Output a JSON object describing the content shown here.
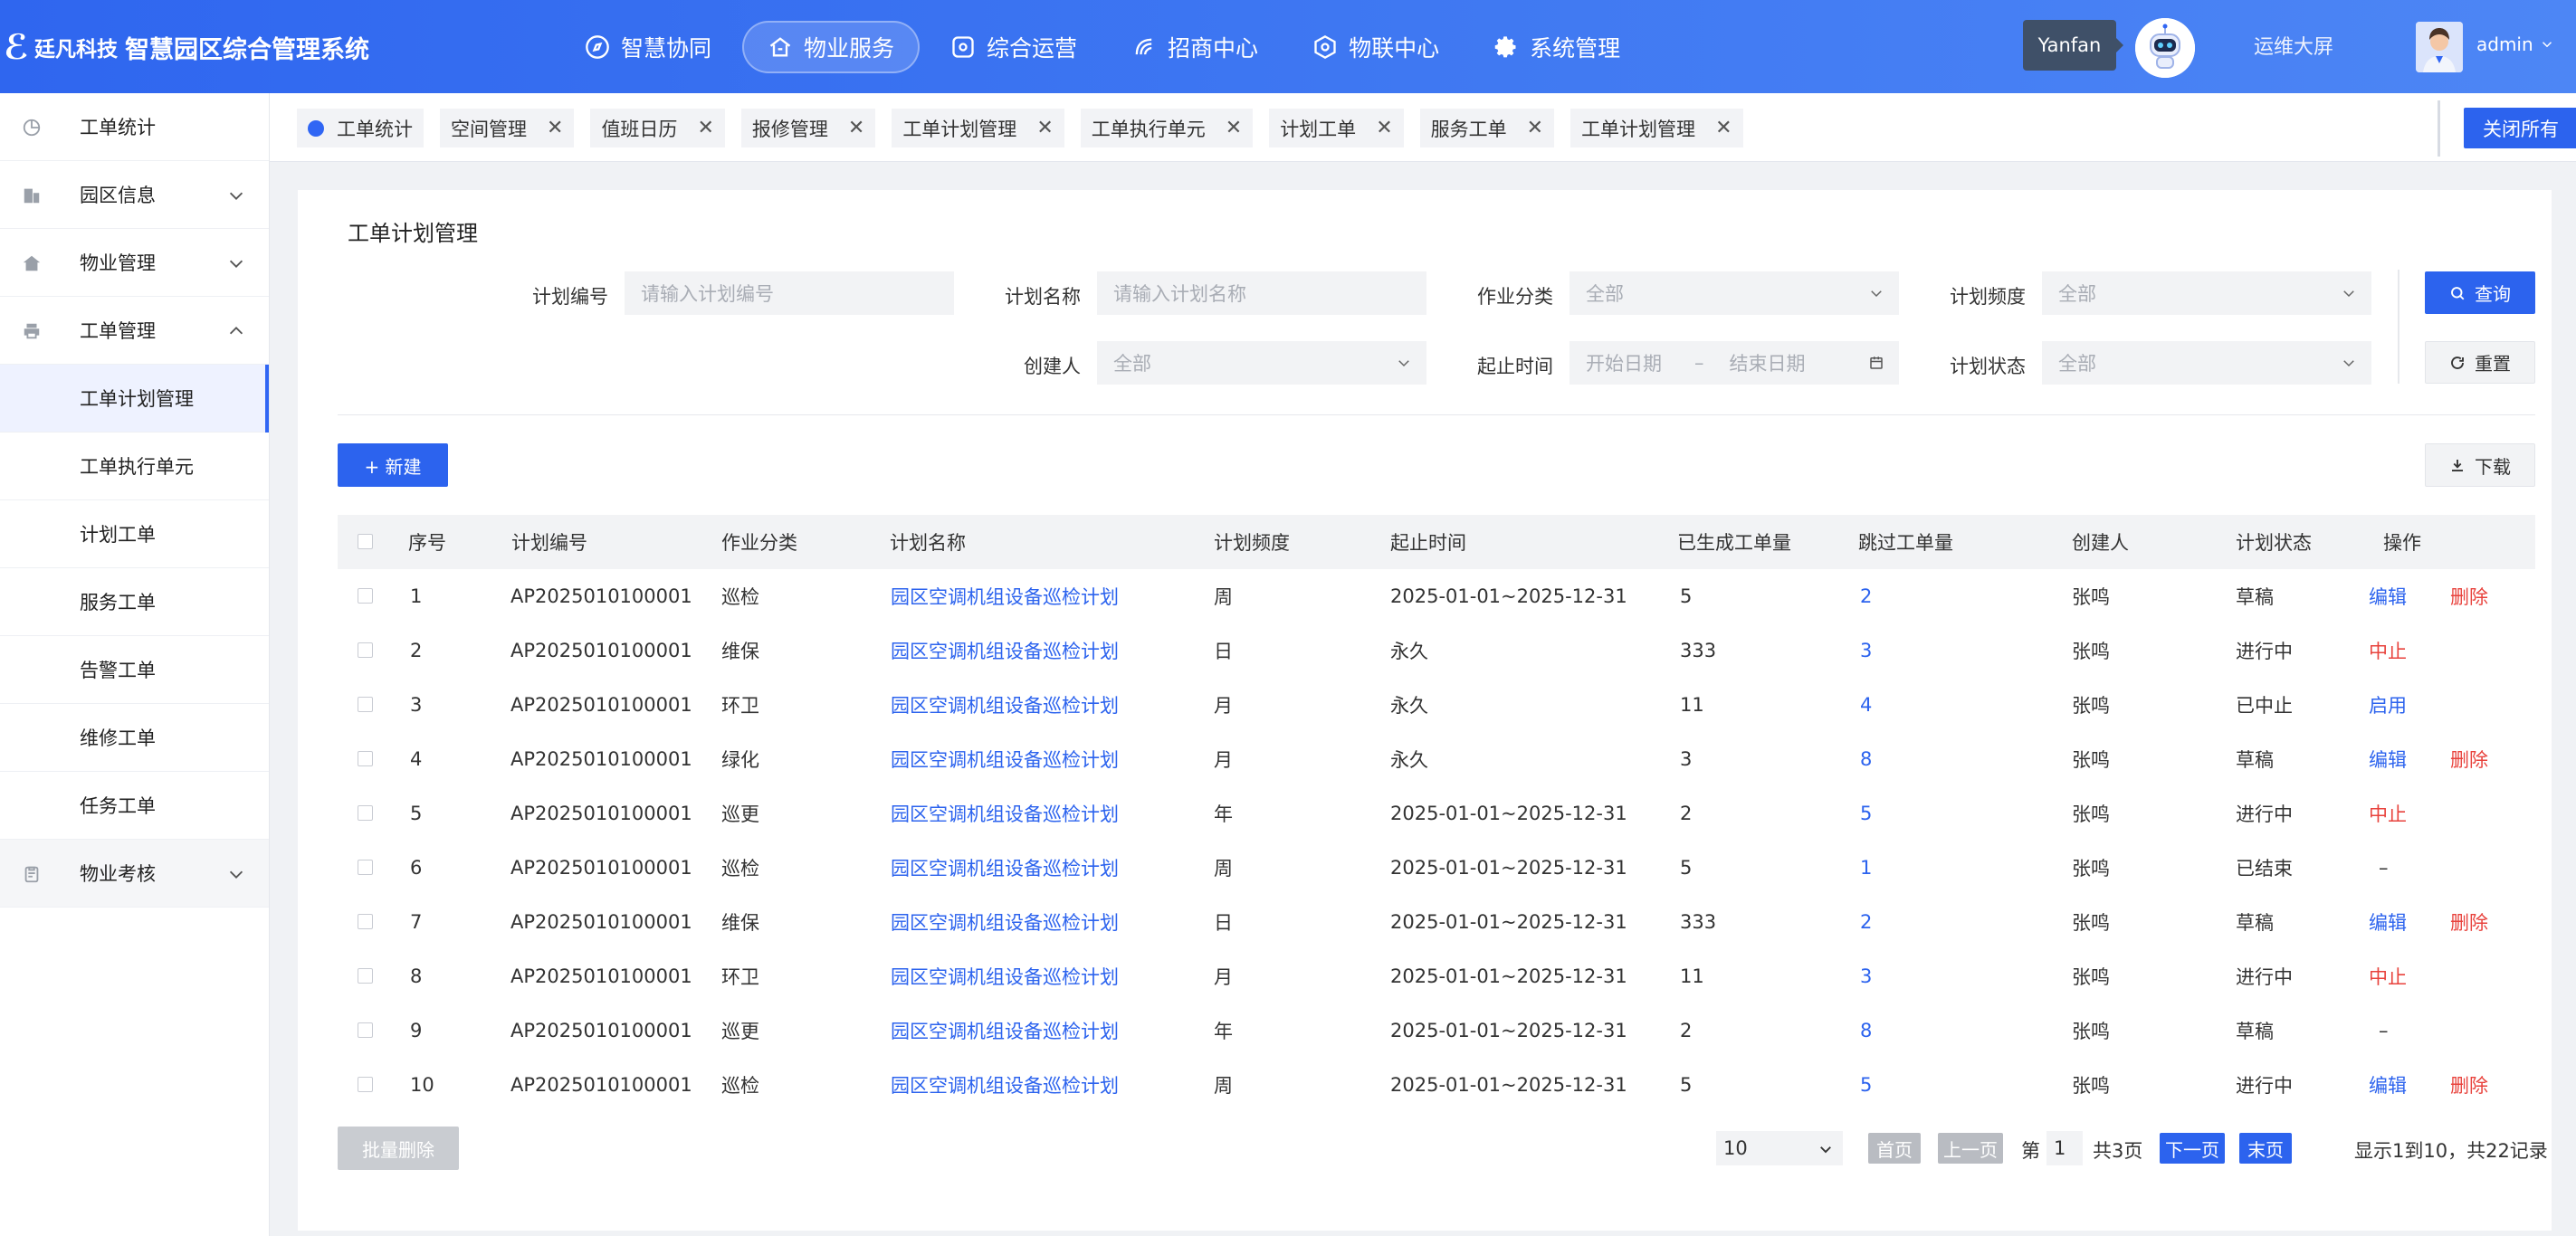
{
  "header": {
    "company": "廷凡科技",
    "system": "智慧园区综合管理系统",
    "nav": [
      {
        "label": "智慧协同",
        "icon": "compass-icon"
      },
      {
        "label": "物业服务",
        "icon": "house-icon"
      },
      {
        "label": "综合运营",
        "icon": "operations-icon"
      },
      {
        "label": "招商中心",
        "icon": "merchant-icon"
      },
      {
        "label": "物联中心",
        "icon": "iot-icon"
      },
      {
        "label": "系统管理",
        "icon": "gear-icon"
      }
    ],
    "tooltip": "Yanfan",
    "screen_link": "运维大屏",
    "user": "admin"
  },
  "sidebar": {
    "items": [
      {
        "label": "工单统计"
      },
      {
        "label": "园区信息"
      },
      {
        "label": "物业管理"
      },
      {
        "label": "工单管理"
      },
      {
        "label": "物业考核"
      }
    ],
    "sub_items": [
      {
        "label": "工单计划管理"
      },
      {
        "label": "工单执行单元"
      },
      {
        "label": "计划工单"
      },
      {
        "label": "服务工单"
      },
      {
        "label": "告警工单"
      },
      {
        "label": "维修工单"
      },
      {
        "label": "任务工单"
      }
    ]
  },
  "tabs": [
    {
      "label": "工单统计"
    },
    {
      "label": "空间管理"
    },
    {
      "label": "值班日历"
    },
    {
      "label": "报修管理"
    },
    {
      "label": "工单计划管理"
    },
    {
      "label": "工单执行单元"
    },
    {
      "label": "计划工单"
    },
    {
      "label": "服务工单"
    },
    {
      "label": "工单计划管理"
    }
  ],
  "close_all": "关闭所有",
  "page": {
    "title": "工单计划管理",
    "filters": {
      "plan_no_label": "计划编号",
      "plan_no_placeholder": "请输入计划编号",
      "plan_name_label": "计划名称",
      "plan_name_placeholder": "请输入计划名称",
      "category_label": "作业分类",
      "category_value": "全部",
      "frequency_label": "计划频度",
      "frequency_value": "全部",
      "creator_label": "创建人",
      "creator_value": "全部",
      "period_label": "起止时间",
      "start_placeholder": "开始日期",
      "range_sep": "–",
      "end_placeholder": "结束日期",
      "status_label": "计划状态",
      "status_value": "全部"
    },
    "query_btn": "查询",
    "reset_btn": "重置",
    "new_btn": "+ 新建",
    "download_btn": "下载",
    "batch_delete": "批量删除"
  },
  "table": {
    "headers": [
      "序号",
      "计划编号",
      "作业分类",
      "计划名称",
      "计划频度",
      "起止时间",
      "已生成工单量",
      "跳过工单量",
      "创建人",
      "计划状态",
      "操作"
    ],
    "rows": [
      {
        "seq": "1",
        "no": "AP2025010100001",
        "cat": "巡检",
        "name": "园区空调机组设备巡检计划",
        "freq": "周",
        "period": "2025-01-01~2025-12-31",
        "generated": "5",
        "skipped": "2",
        "creator": "张鸣",
        "status": "草稿",
        "op1": "编辑",
        "op1_color": "#2c63ee",
        "op2": "删除"
      },
      {
        "seq": "2",
        "no": "AP2025010100001",
        "cat": "维保",
        "name": "园区空调机组设备巡检计划",
        "freq": "日",
        "period": "永久",
        "generated": "333",
        "skipped": "3",
        "creator": "张鸣",
        "status": "进行中",
        "op1": "中止",
        "op1_color": "#e8423c",
        "op2": ""
      },
      {
        "seq": "3",
        "no": "AP2025010100001",
        "cat": "环卫",
        "name": "园区空调机组设备巡检计划",
        "freq": "月",
        "period": "永久",
        "generated": "11",
        "skipped": "4",
        "creator": "张鸣",
        "status": "已中止",
        "op1": "启用",
        "op1_color": "#2c63ee",
        "op2": ""
      },
      {
        "seq": "4",
        "no": "AP2025010100001",
        "cat": "绿化",
        "name": "园区空调机组设备巡检计划",
        "freq": "月",
        "period": "永久",
        "generated": "3",
        "skipped": "8",
        "creator": "张鸣",
        "status": "草稿",
        "op1": "编辑",
        "op1_color": "#2c63ee",
        "op2": "删除"
      },
      {
        "seq": "5",
        "no": "AP2025010100001",
        "cat": "巡更",
        "name": "园区空调机组设备巡检计划",
        "freq": "年",
        "period": "2025-01-01~2025-12-31",
        "generated": "2",
        "skipped": "5",
        "creator": "张鸣",
        "status": "进行中",
        "op1": "中止",
        "op1_color": "#e8423c",
        "op2": ""
      },
      {
        "seq": "6",
        "no": "AP2025010100001",
        "cat": "巡检",
        "name": "园区空调机组设备巡检计划",
        "freq": "周",
        "period": "2025-01-01~2025-12-31",
        "generated": "5",
        "skipped": "1",
        "creator": "张鸣",
        "status": "已结束",
        "op1": "–",
        "op1_color": "#333333",
        "op2": ""
      },
      {
        "seq": "7",
        "no": "AP2025010100001",
        "cat": "维保",
        "name": "园区空调机组设备巡检计划",
        "freq": "日",
        "period": "2025-01-01~2025-12-31",
        "generated": "333",
        "skipped": "2",
        "creator": "张鸣",
        "status": "草稿",
        "op1": "编辑",
        "op1_color": "#2c63ee",
        "op2": "删除"
      },
      {
        "seq": "8",
        "no": "AP2025010100001",
        "cat": "环卫",
        "name": "园区空调机组设备巡检计划",
        "freq": "月",
        "period": "2025-01-01~2025-12-31",
        "generated": "11",
        "skipped": "3",
        "creator": "张鸣",
        "status": "进行中",
        "op1": "中止",
        "op1_color": "#e8423c",
        "op2": ""
      },
      {
        "seq": "9",
        "no": "AP2025010100001",
        "cat": "巡更",
        "name": "园区空调机组设备巡检计划",
        "freq": "年",
        "period": "2025-01-01~2025-12-31",
        "generated": "2",
        "skipped": "8",
        "creator": "张鸣",
        "status": "草稿",
        "op1": "–",
        "op1_color": "#333333",
        "op2": ""
      },
      {
        "seq": "10",
        "no": "AP2025010100001",
        "cat": "巡检",
        "name": "园区空调机组设备巡检计划",
        "freq": "周",
        "period": "2025-01-01~2025-12-31",
        "generated": "5",
        "skipped": "5",
        "creator": "张鸣",
        "status": "进行中",
        "op1": "编辑",
        "op1_color": "#2c63ee",
        "op2": "删除"
      }
    ]
  },
  "pagination": {
    "page_size": "10",
    "first": "首页",
    "prev": "上一页",
    "page_prefix": "第",
    "page_num": "1",
    "total_pages": "共3页",
    "next": "下一页",
    "last": "末页",
    "summary": "显示1到10，共22记录"
  },
  "colors": {
    "primary": "#2c63ee",
    "danger": "#e8423c",
    "header_bg": "#3f78f2"
  }
}
